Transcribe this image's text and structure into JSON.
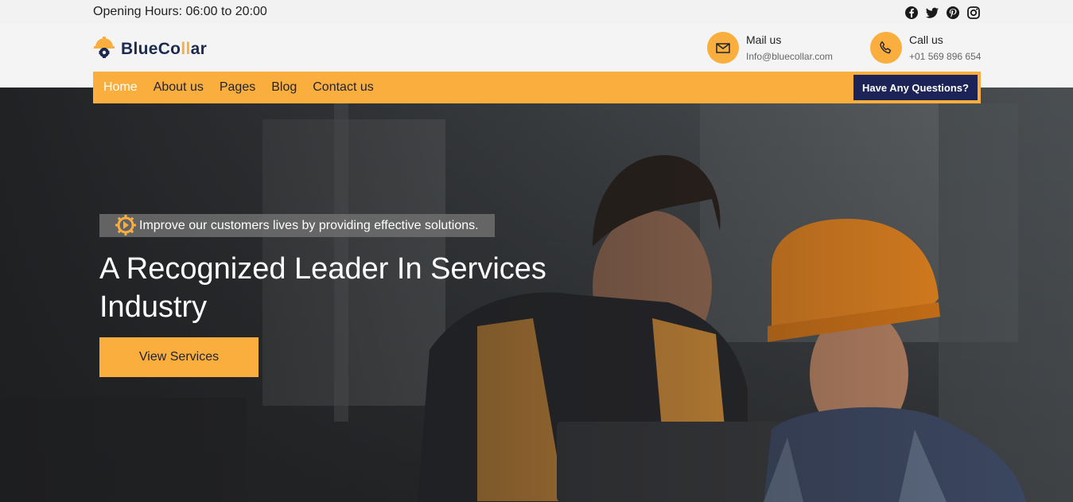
{
  "topbar": {
    "hours": "Opening Hours: 06:00 to 20:00",
    "social": [
      "facebook-icon",
      "twitter-icon",
      "pinterest-icon",
      "instagram-icon"
    ]
  },
  "brand": {
    "name_part1": "BlueCo",
    "name_accent": "ll",
    "name_part2": "ar",
    "color": "#1c2a4f",
    "accent": "#f9ae3d"
  },
  "contact": {
    "mail_label": "Mail us",
    "mail_value": "Info@bluecollar.com",
    "call_label": "Call us",
    "call_value": "+01 569 896 654"
  },
  "nav": {
    "items": [
      "Home",
      "About us",
      "Pages",
      "Blog",
      "Contact us"
    ],
    "active": "Home",
    "cta": "Have Any Questions?"
  },
  "hero": {
    "tagline": "Improve our customers lives by providing effective solutions.",
    "headline": "A Recognized Leader In Services Industry",
    "button": "View Services"
  },
  "colors": {
    "accent": "#f9ae3d",
    "navy": "#1c2457"
  }
}
